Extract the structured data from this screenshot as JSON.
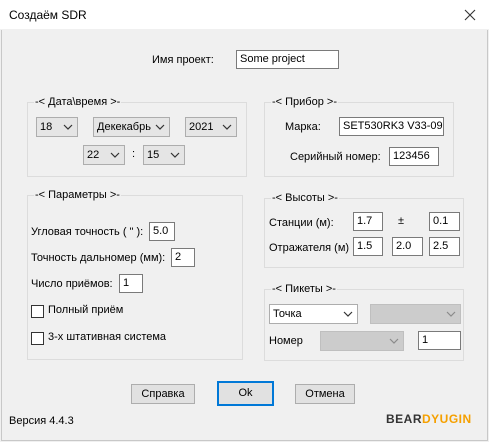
{
  "window": {
    "title": "Создаём SDR"
  },
  "project": {
    "label": "Имя проект:",
    "value": "Some project"
  },
  "datetime": {
    "group_title": "-< Дата\\время >-",
    "day": "18",
    "month": "Декекабрь",
    "year": "2021",
    "hour": "22",
    "separator": ":",
    "minute": "15"
  },
  "device": {
    "group_title": "-< Прибор >-",
    "brand_label": "Марка:",
    "brand_value": "SET530RK3 V33-09",
    "serial_label": "Серийный номер:",
    "serial_value": "123456"
  },
  "params": {
    "group_title": "-< Параметры >-",
    "angular_label": "Угловая точность ( \" ):",
    "angular_value": "5.0",
    "distance_label": "Точность дальномер (мм):",
    "distance_value": "2",
    "reps_label": "Число приёмов:",
    "reps_value": "1",
    "full_label": "Полный приём",
    "full_checked": false,
    "tripod_label": "3-х штативная система",
    "tripod_checked": false
  },
  "heights": {
    "group_title": "-< Высоты >-",
    "station_label": "Станции (м):",
    "station_value": "1.7",
    "pm_symbol": "±",
    "station_tol": "0.1",
    "reflector_label": "Отражателя (м)",
    "reflector_values": [
      "1.5",
      "2.0",
      "2.5"
    ]
  },
  "pickets": {
    "group_title": "-< Пикеты >-",
    "type_value": "Точка",
    "number_label": "Номер",
    "number_value": "1"
  },
  "buttons": {
    "help": "Справка",
    "ok": "Ok",
    "cancel": "Отмена"
  },
  "footer": {
    "version": "Версия 4.4.3",
    "brand_a": "BEAR",
    "brand_b": "DYUGIN"
  },
  "colors": {
    "brand_dark": "#333333",
    "brand_accent": "#f5a000",
    "focus": "#0078d7"
  }
}
